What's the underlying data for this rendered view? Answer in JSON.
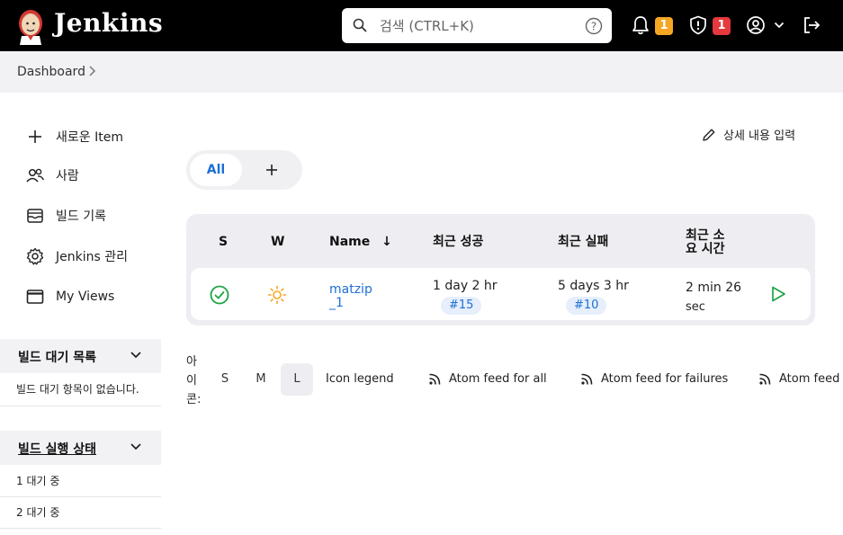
{
  "header": {
    "brand": "Jenkins",
    "search_placeholder": "검색 (CTRL+K)",
    "notifications_count": "1",
    "security_count": "1"
  },
  "breadcrumb": {
    "items": [
      "Dashboard"
    ]
  },
  "sidebar": {
    "items": [
      {
        "label": "새로운 Item",
        "icon": "plus-icon"
      },
      {
        "label": "사람",
        "icon": "people-icon"
      },
      {
        "label": "빌드 기록",
        "icon": "build-history-icon"
      },
      {
        "label": "Jenkins 관리",
        "icon": "gear-icon"
      },
      {
        "label": "My Views",
        "icon": "window-icon"
      }
    ],
    "build_queue": {
      "title": "빌드 대기 목록",
      "empty_text": "빌드 대기 항목이 없습니다."
    },
    "executors": {
      "title": "빌드 실행 상태",
      "rows": [
        "1  대기 중",
        "2  대기 중"
      ]
    }
  },
  "main": {
    "edit_description": "상세 내용 입력",
    "tabs": {
      "all_label": "All",
      "add_label": "+"
    },
    "table": {
      "headers": {
        "s": "S",
        "w": "W",
        "name": "Name",
        "name_sort": "↓",
        "last_success": "최근 성공",
        "last_failure": "최근 실패",
        "last_duration_line1": "최근 소",
        "last_duration_line2": "요 시간"
      },
      "rows": [
        {
          "name_line1": "matzip",
          "name_line2": "_1",
          "last_success": "1 day 2 hr",
          "last_success_build": "#15",
          "last_failure": "5 days 3 hr",
          "last_failure_build": "#10",
          "duration_line1": "2 min 26",
          "duration_line2": "sec"
        }
      ]
    },
    "icon_size": {
      "label_line1": "아",
      "label_line2": "이",
      "label_line3": "콘:",
      "sizes": [
        "S",
        "M",
        "L"
      ],
      "selected": "L"
    },
    "legend": {
      "icon_legend": "Icon legend",
      "atom_all": "Atom feed for all",
      "atom_failures": "Atom feed for failures",
      "atom_latest": "Atom feed"
    }
  },
  "colors": {
    "accent": "#1d6fd6",
    "success": "#1ea446",
    "sun": "#f5a623",
    "badge_orange": "#f5a623",
    "badge_red": "#e5393d"
  }
}
